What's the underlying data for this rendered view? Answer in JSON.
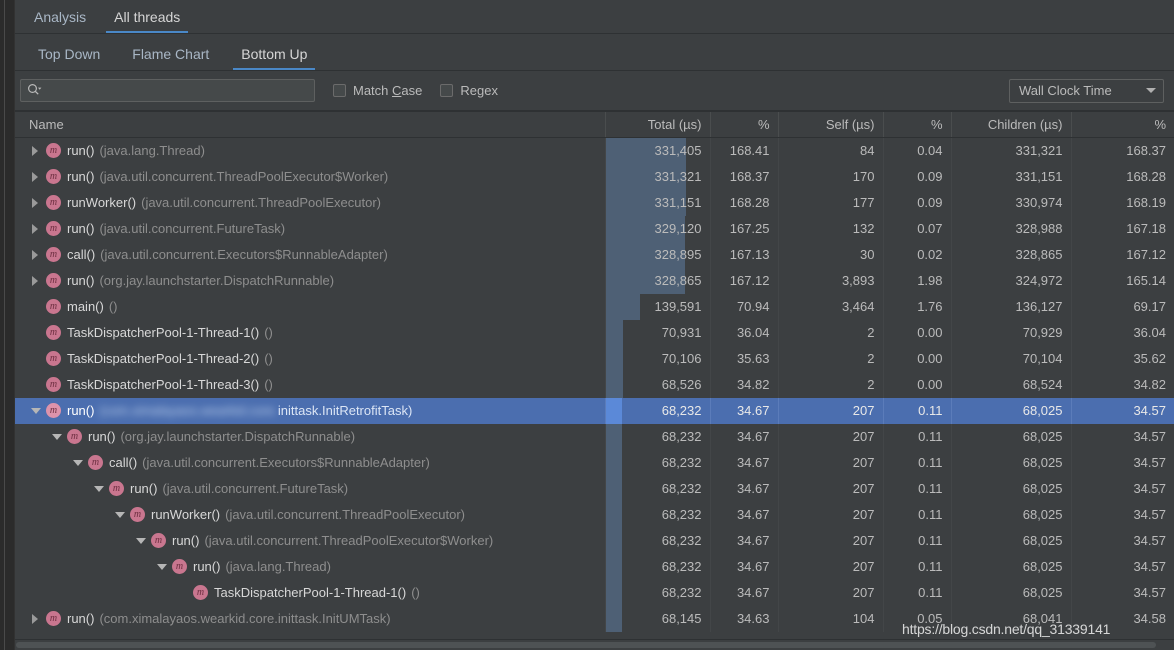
{
  "top_tabs": [
    {
      "label": "Analysis",
      "active": false
    },
    {
      "label": "All threads",
      "active": true
    }
  ],
  "sub_tabs": [
    {
      "label": "Top Down",
      "active": false
    },
    {
      "label": "Flame Chart",
      "active": false
    },
    {
      "label": "Bottom Up",
      "active": true
    }
  ],
  "toolbar": {
    "search_value": "",
    "search_placeholder": "",
    "match_case_label": "Match Case",
    "match_case_mnemonic": "C",
    "match_case_checked": false,
    "regex_label": "Regex",
    "regex_checked": false,
    "clock_select_value": "Wall Clock Time"
  },
  "colors": {
    "background": "#3c3f41",
    "selection": "#4b6eaf",
    "tab_underline": "#4a88c7",
    "bar": "#4e6075",
    "bar_selected": "#5b89d8",
    "method_icon": "#c9768f",
    "text": "#bbbbbb",
    "text_muted": "#8e8e8e"
  },
  "table": {
    "columns": [
      {
        "label": "Name",
        "align": "left"
      },
      {
        "label": "Total (µs)",
        "align": "right"
      },
      {
        "label": "%",
        "align": "right"
      },
      {
        "label": "Self (µs)",
        "align": "right"
      },
      {
        "label": "%",
        "align": "right"
      },
      {
        "label": "Children (µs)",
        "align": "right"
      },
      {
        "label": "%",
        "align": "right"
      }
    ],
    "bar_max": 331405,
    "rows": [
      {
        "depth": 0,
        "arrow": "right",
        "method": "run()",
        "pkg": "(java.lang.Thread)",
        "total": "331,405",
        "total_val": 331405,
        "pct_total": "168.41",
        "self": "84",
        "pct_self": "0.04",
        "children": "331,321",
        "pct_children": "168.37",
        "selected": false,
        "blurred": false
      },
      {
        "depth": 0,
        "arrow": "right",
        "method": "run()",
        "pkg": "(java.util.concurrent.ThreadPoolExecutor$Worker)",
        "total": "331,321",
        "total_val": 331321,
        "pct_total": "168.37",
        "self": "170",
        "pct_self": "0.09",
        "children": "331,151",
        "pct_children": "168.28",
        "selected": false,
        "blurred": false
      },
      {
        "depth": 0,
        "arrow": "right",
        "method": "runWorker()",
        "pkg": "(java.util.concurrent.ThreadPoolExecutor)",
        "total": "331,151",
        "total_val": 331151,
        "pct_total": "168.28",
        "self": "177",
        "pct_self": "0.09",
        "children": "330,974",
        "pct_children": "168.19",
        "selected": false,
        "blurred": false
      },
      {
        "depth": 0,
        "arrow": "right",
        "method": "run()",
        "pkg": "(java.util.concurrent.FutureTask)",
        "total": "329,120",
        "total_val": 329120,
        "pct_total": "167.25",
        "self": "132",
        "pct_self": "0.07",
        "children": "328,988",
        "pct_children": "167.18",
        "selected": false,
        "blurred": false
      },
      {
        "depth": 0,
        "arrow": "right",
        "method": "call()",
        "pkg": "(java.util.concurrent.Executors$RunnableAdapter)",
        "total": "328,895",
        "total_val": 328895,
        "pct_total": "167.13",
        "self": "30",
        "pct_self": "0.02",
        "children": "328,865",
        "pct_children": "167.12",
        "selected": false,
        "blurred": false
      },
      {
        "depth": 0,
        "arrow": "right",
        "method": "run()",
        "pkg": "(org.jay.launchstarter.DispatchRunnable)",
        "total": "328,865",
        "total_val": 328865,
        "pct_total": "167.12",
        "self": "3,893",
        "pct_self": "1.98",
        "children": "324,972",
        "pct_children": "165.14",
        "selected": false,
        "blurred": false
      },
      {
        "depth": 0,
        "arrow": "none",
        "method": "main()",
        "pkg": "()",
        "total": "139,591",
        "total_val": 139591,
        "pct_total": "70.94",
        "self": "3,464",
        "pct_self": "1.76",
        "children": "136,127",
        "pct_children": "69.17",
        "selected": false,
        "blurred": false
      },
      {
        "depth": 0,
        "arrow": "none",
        "method": "TaskDispatcherPool-1-Thread-1()",
        "pkg": "()",
        "total": "70,931",
        "total_val": 70931,
        "pct_total": "36.04",
        "self": "2",
        "pct_self": "0.00",
        "children": "70,929",
        "pct_children": "36.04",
        "selected": false,
        "blurred": false
      },
      {
        "depth": 0,
        "arrow": "none",
        "method": "TaskDispatcherPool-1-Thread-2()",
        "pkg": "()",
        "total": "70,106",
        "total_val": 70106,
        "pct_total": "35.63",
        "self": "2",
        "pct_self": "0.00",
        "children": "70,104",
        "pct_children": "35.62",
        "selected": false,
        "blurred": false
      },
      {
        "depth": 0,
        "arrow": "none",
        "method": "TaskDispatcherPool-1-Thread-3()",
        "pkg": "()",
        "total": "68,526",
        "total_val": 68526,
        "pct_total": "34.82",
        "self": "2",
        "pct_self": "0.00",
        "children": "68,524",
        "pct_children": "34.82",
        "selected": false,
        "blurred": false
      },
      {
        "depth": 0,
        "arrow": "down",
        "method": "run()",
        "pkg": "(com.ximalayaos.wearkid.core.inittask.InitRetrofitTask)",
        "pkg_visible_tail": "inittask.InitRetrofitTask)",
        "pkg_blurred_head": "(com.ximalayaos.wearkid.core.",
        "total": "68,232",
        "total_val": 68232,
        "pct_total": "34.67",
        "self": "207",
        "pct_self": "0.11",
        "children": "68,025",
        "pct_children": "34.57",
        "selected": true,
        "blurred": true
      },
      {
        "depth": 1,
        "arrow": "down",
        "method": "run()",
        "pkg": "(org.jay.launchstarter.DispatchRunnable)",
        "total": "68,232",
        "total_val": 68232,
        "pct_total": "34.67",
        "self": "207",
        "pct_self": "0.11",
        "children": "68,025",
        "pct_children": "34.57",
        "selected": false,
        "blurred": false
      },
      {
        "depth": 2,
        "arrow": "down",
        "method": "call()",
        "pkg": "(java.util.concurrent.Executors$RunnableAdapter)",
        "total": "68,232",
        "total_val": 68232,
        "pct_total": "34.67",
        "self": "207",
        "pct_self": "0.11",
        "children": "68,025",
        "pct_children": "34.57",
        "selected": false,
        "blurred": false
      },
      {
        "depth": 3,
        "arrow": "down",
        "method": "run()",
        "pkg": "(java.util.concurrent.FutureTask)",
        "total": "68,232",
        "total_val": 68232,
        "pct_total": "34.67",
        "self": "207",
        "pct_self": "0.11",
        "children": "68,025",
        "pct_children": "34.57",
        "selected": false,
        "blurred": false
      },
      {
        "depth": 4,
        "arrow": "down",
        "method": "runWorker()",
        "pkg": "(java.util.concurrent.ThreadPoolExecutor)",
        "total": "68,232",
        "total_val": 68232,
        "pct_total": "34.67",
        "self": "207",
        "pct_self": "0.11",
        "children": "68,025",
        "pct_children": "34.57",
        "selected": false,
        "blurred": false
      },
      {
        "depth": 5,
        "arrow": "down",
        "method": "run()",
        "pkg": "(java.util.concurrent.ThreadPoolExecutor$Worker)",
        "total": "68,232",
        "total_val": 68232,
        "pct_total": "34.67",
        "self": "207",
        "pct_self": "0.11",
        "children": "68,025",
        "pct_children": "34.57",
        "selected": false,
        "blurred": false
      },
      {
        "depth": 6,
        "arrow": "down",
        "method": "run()",
        "pkg": "(java.lang.Thread)",
        "total": "68,232",
        "total_val": 68232,
        "pct_total": "34.67",
        "self": "207",
        "pct_self": "0.11",
        "children": "68,025",
        "pct_children": "34.57",
        "selected": false,
        "blurred": false
      },
      {
        "depth": 7,
        "arrow": "none",
        "method": "TaskDispatcherPool-1-Thread-1()",
        "pkg": "()",
        "total": "68,232",
        "total_val": 68232,
        "pct_total": "34.67",
        "self": "207",
        "pct_self": "0.11",
        "children": "68,025",
        "pct_children": "34.57",
        "selected": false,
        "blurred": false
      },
      {
        "depth": 0,
        "arrow": "right",
        "method": "run()",
        "pkg": "(com.ximalayaos.wearkid.core.inittask.InitUMTask)",
        "total": "68,145",
        "total_val": 68145,
        "pct_total": "34.63",
        "self": "104",
        "pct_self": "0.05",
        "children": "68,041",
        "pct_children": "34.58",
        "selected": false,
        "blurred": false
      }
    ]
  },
  "watermark": {
    "text": "https://blog.csdn.net/qq_31339141"
  }
}
